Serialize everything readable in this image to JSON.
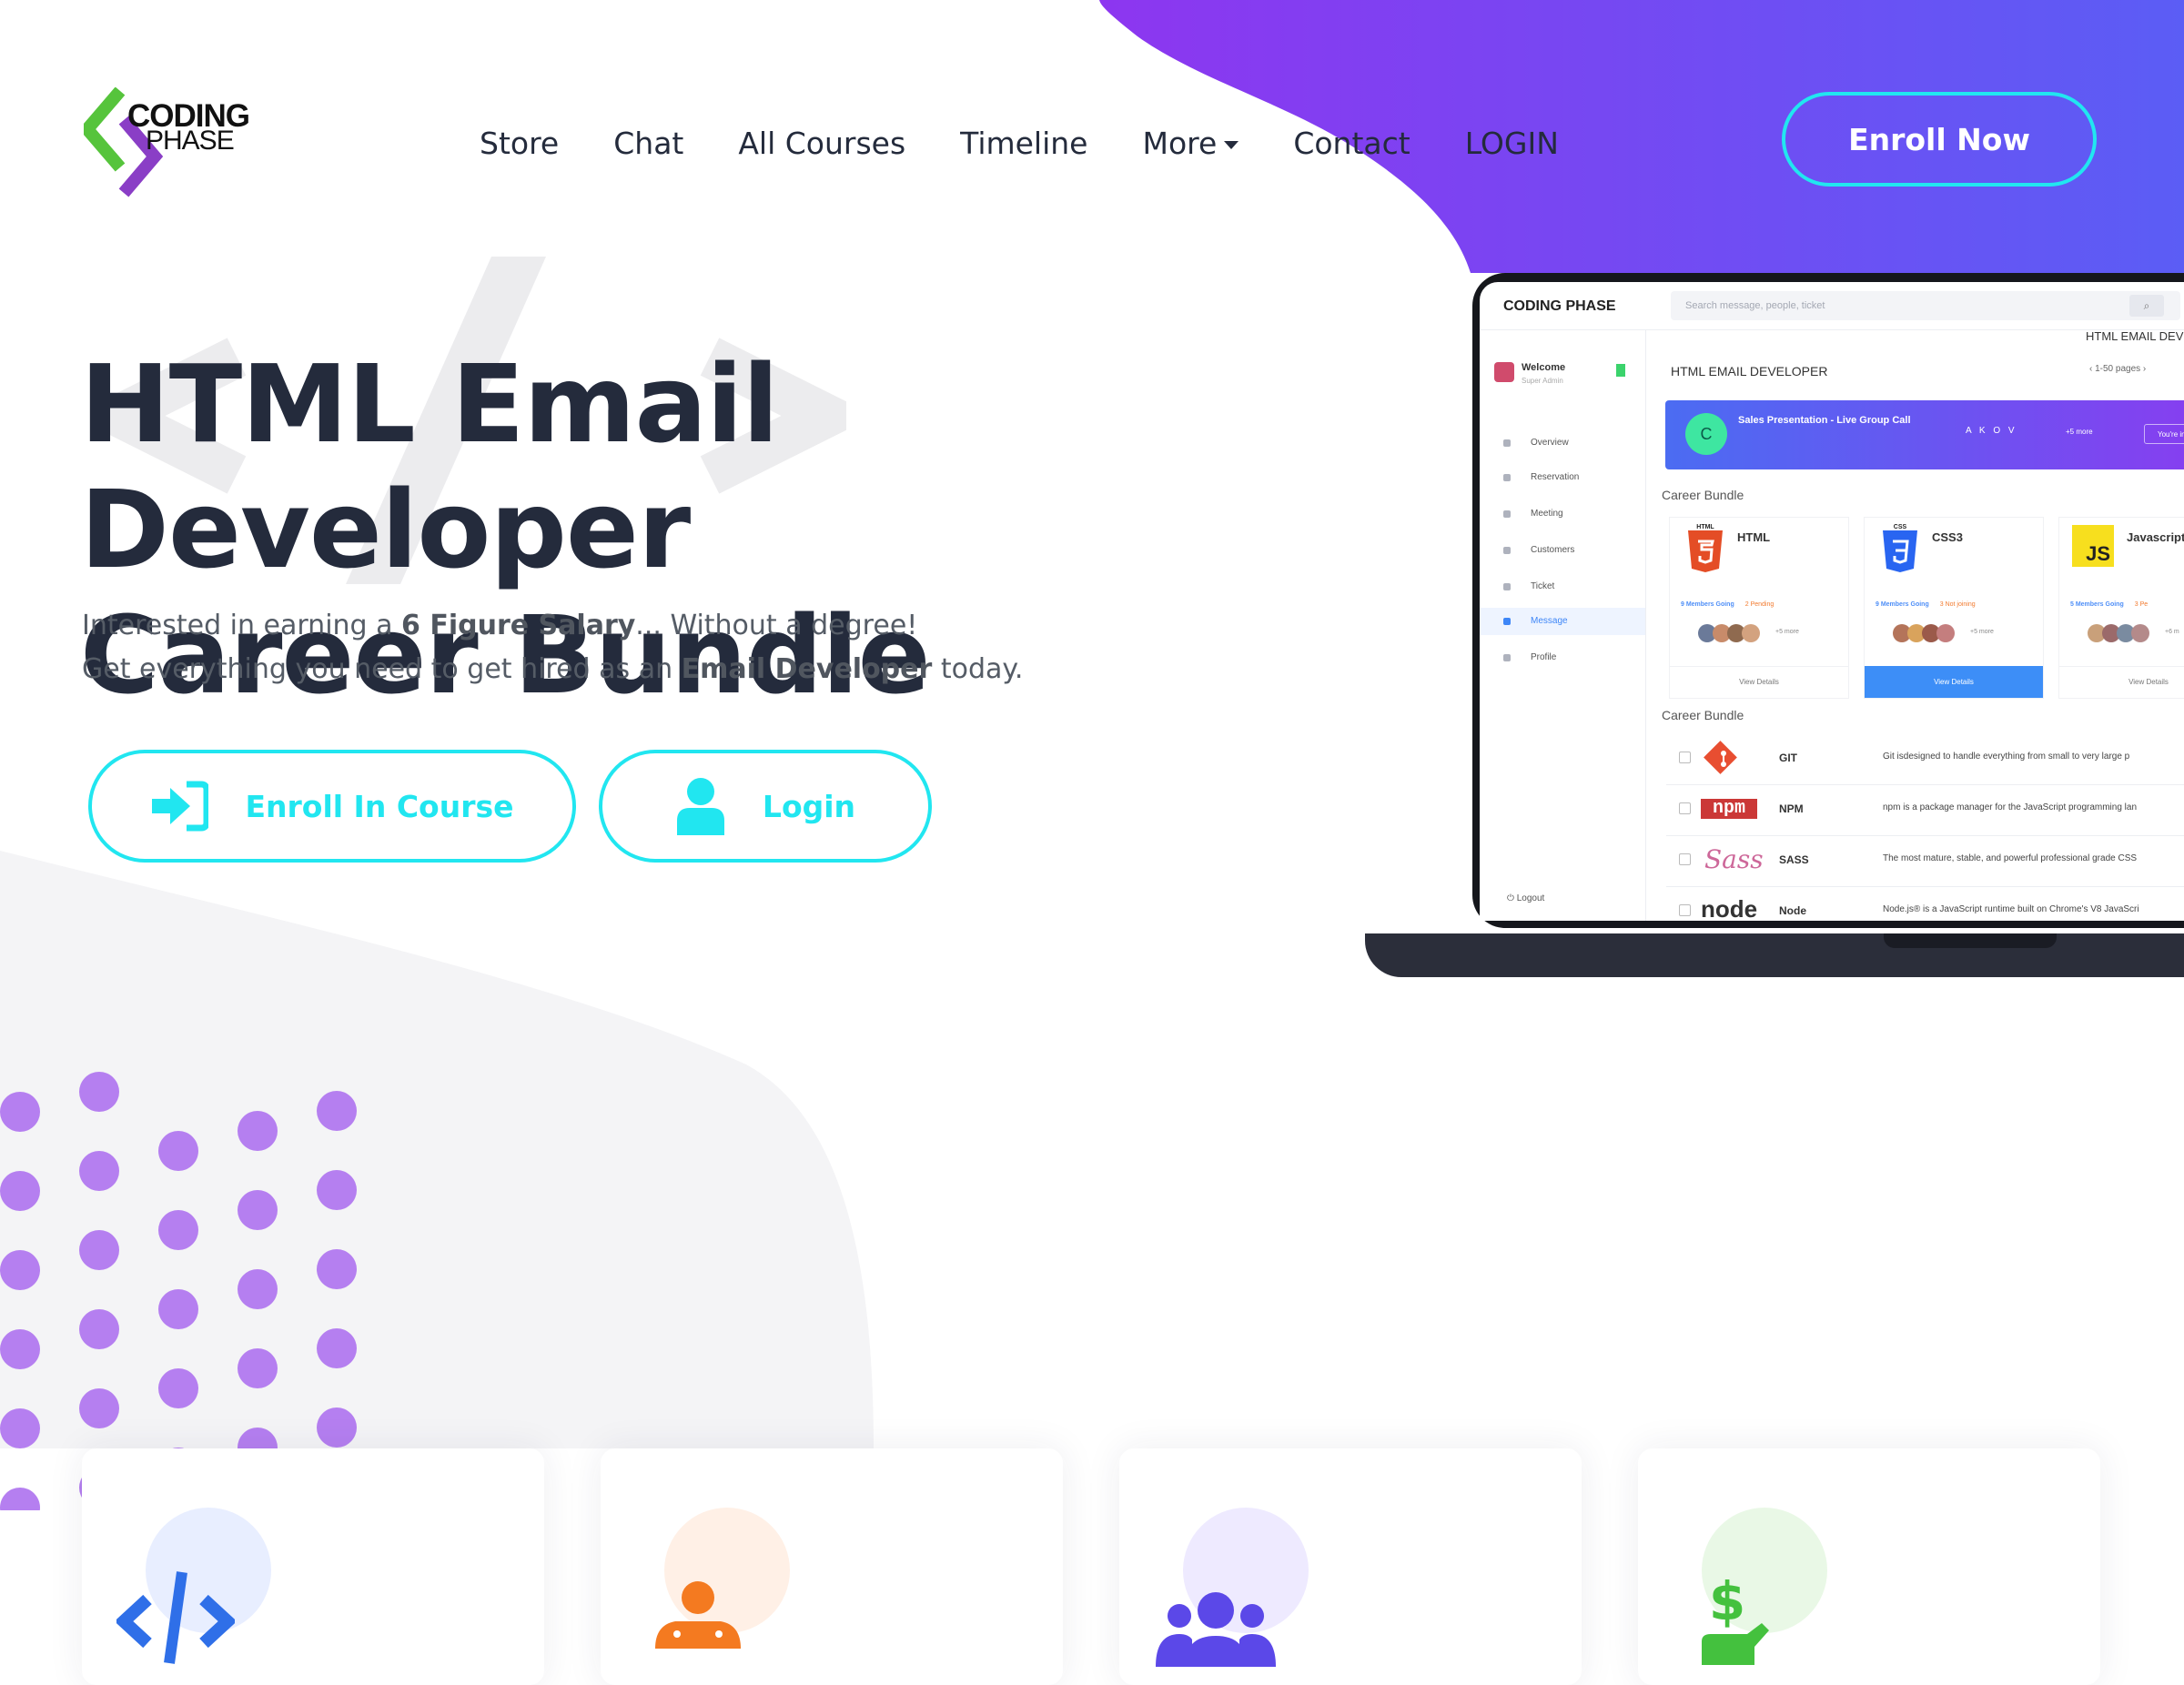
{
  "brand": {
    "name_line1": "CODING",
    "name_line2": "PHASE"
  },
  "nav": {
    "items": [
      {
        "label": "Store"
      },
      {
        "label": "Chat"
      },
      {
        "label": "All Courses"
      },
      {
        "label": "Timeline"
      },
      {
        "label": "More",
        "has_dropdown": true
      },
      {
        "label": "Contact"
      },
      {
        "label": "LOGIN"
      }
    ],
    "cta_label": "Enroll Now"
  },
  "hero": {
    "title_line1": "HTML Email Developer",
    "title_line2": "Career Bundle",
    "sub1_pre": "Interested in earning a ",
    "sub1_bold": "6 Figure Salary",
    "sub1_post": "... Without a degree!",
    "sub2_pre": "Get everything you need to get hired as an ",
    "sub2_bold": "Email Developer",
    "sub2_post": " today.",
    "enroll_button": "Enroll In Course",
    "login_button": "Login"
  },
  "colors": {
    "accent_cyan": "#21e6f0",
    "purple_start": "#8d36f0",
    "purple_end": "#5b5df5",
    "heading": "#242b3c",
    "dots": "#b57ff0"
  },
  "laptop": {
    "brand": "CODING PHASE",
    "search_placeholder": "Search message, people, ticket",
    "breadcrumb": "HTML EMAIL DEVELOPER",
    "page_title": "HTML EMAIL DEVELOPER",
    "pager": "‹   1-50 pages   ›",
    "welcome": "Welcome",
    "welcome_sub": "Super Admin",
    "menu": [
      "Overview",
      "Reservation",
      "Meeting",
      "Customers",
      "Ticket",
      "Message",
      "Profile"
    ],
    "logout": "Logout",
    "banner": {
      "initial": "C",
      "title": "Sales Presentation  -  Live Group Call",
      "avatars": "A K O V",
      "more": "+5 more",
      "button": "You're invited"
    },
    "section1": "Career Bundle",
    "section2": "Career Bundle",
    "cards": [
      {
        "name": "HTML",
        "badge": "HTML",
        "members": "9 Members Going",
        "status": "2 Pending",
        "more": "+5 more",
        "footer": "View Details"
      },
      {
        "name": "CSS3",
        "badge": "CSS",
        "members": "9 Members Going",
        "status": "3 Not joining",
        "more": "+5 more",
        "footer": "View Details"
      },
      {
        "name": "Javascript",
        "badge": "JS",
        "members": "5 Members Going",
        "status": "3 Pe",
        "more": "+6 m",
        "footer": "View Details"
      }
    ],
    "rows": [
      {
        "name": "GIT",
        "desc": "Git isdesigned to handle everything from small to very large p"
      },
      {
        "name": "NPM",
        "logo_text": "npm",
        "desc": "npm is a package manager for the JavaScript programming lan"
      },
      {
        "name": "SASS",
        "logo_text": "Sass",
        "desc": "The most mature, stable, and powerful professional grade CSS"
      },
      {
        "name": "Node",
        "logo_text": "node",
        "desc": "Node.js® is a JavaScript runtime built on Chrome's V8 JavaScri"
      }
    ]
  },
  "features": [
    {
      "icon": "code-icon",
      "halo": "#e8eeff"
    },
    {
      "icon": "person-icon",
      "halo": "#fff0e6"
    },
    {
      "icon": "group-icon",
      "halo": "#eeeaff"
    },
    {
      "icon": "dollar-icon",
      "halo": "#e9f8e6"
    }
  ]
}
